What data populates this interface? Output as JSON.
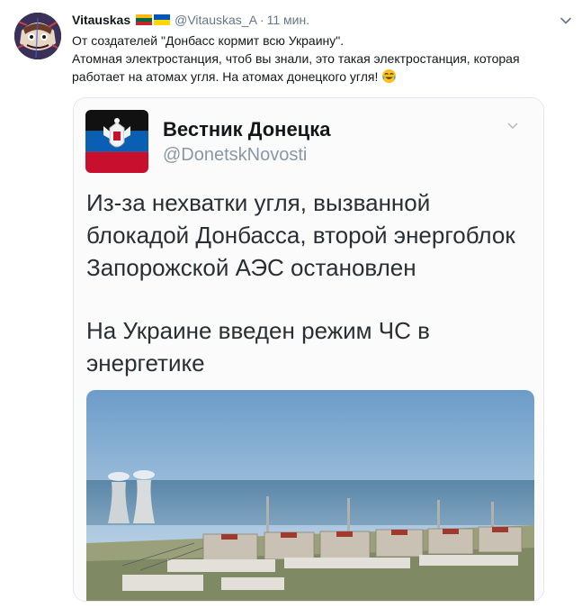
{
  "tweet": {
    "author_name": "Vitauskas",
    "handle": "@Vitauskas_A",
    "separator": "·",
    "time": "11 мин.",
    "text_lines": [
      "От создателей \"Донбасс кормит всю Украину\".",
      "Атомная электростанция, чтоб вы знали, это такая электростанция, которая",
      "работает на атомах угля. На атомах донецкого угля!"
    ],
    "emoji_icon": "face-with-tears-of-joy-icon",
    "flags": [
      "lithuania-flag",
      "ukraine-flag"
    ]
  },
  "embedded": {
    "account_name": "Вестник Донецка",
    "account_handle": "@DonetskNovosti",
    "headline_lines": [
      "Из-за нехватки угля, вызванной",
      "блокадой Донбасса, второй энергоблок",
      "Запорожской АЭС остановлен"
    ],
    "subline_lines": [
      "На Украине введен режим ЧС в",
      "энергетике"
    ],
    "photo_subject": "nuclear-power-plant-photo"
  },
  "colors": {
    "text": "#14171a",
    "muted": "#657786",
    "border": "#e1e8ed",
    "flag_lt": [
      "#fdb913",
      "#006a44",
      "#c1272d"
    ],
    "flag_ua": [
      "#0057b7",
      "#ffd700"
    ],
    "dnr_flag": [
      "#111111",
      "#0b5fb3",
      "#c8102e"
    ]
  }
}
